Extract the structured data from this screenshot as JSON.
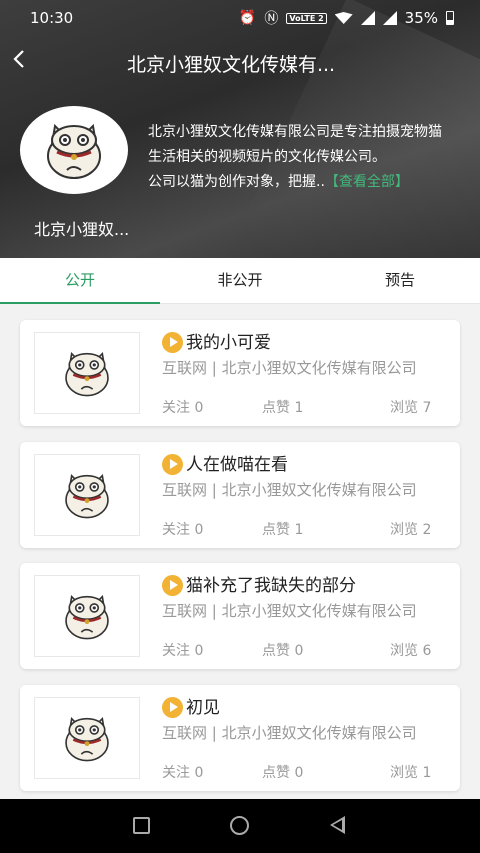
{
  "status_bar": {
    "time": "10:30",
    "volte": "VoLTE 2",
    "battery_pct": "35%",
    "icons": [
      "alarm-icon",
      "nfc-icon",
      "volte-icon",
      "wifi-icon",
      "signal-icon",
      "signal-icon",
      "battery-icon"
    ]
  },
  "header": {
    "back_icon": "chevron-left-icon",
    "title": "北京小狸奴文化传媒有...",
    "company_name": "北京小狸奴...",
    "description": "北京小狸奴文化传媒有限公司是专注拍摄宠物猫生活相关的视频短片的文化传媒公司。",
    "description_line2": "公司以猫为创作对象，把握..",
    "see_all": "【查看全部】"
  },
  "tabs": [
    {
      "label": "公开",
      "active": true
    },
    {
      "label": "非公开",
      "active": false
    },
    {
      "label": "预告",
      "active": false
    }
  ],
  "colors": {
    "accent": "#2a9d63",
    "play": "#f2b233",
    "muted": "#999999"
  },
  "videos": [
    {
      "title": "我的小可爱",
      "sub": "互联网 | 北京小狸奴文化传媒有限公司",
      "follow": "关注 0",
      "likes": "点赞 1",
      "views": "浏览 7"
    },
    {
      "title": "人在做喵在看",
      "sub": "互联网 | 北京小狸奴文化传媒有限公司",
      "follow": "关注 0",
      "likes": "点赞 1",
      "views": "浏览 2"
    },
    {
      "title": "猫补充了我缺失的部分",
      "sub": "互联网 | 北京小狸奴文化传媒有限公司",
      "follow": "关注 0",
      "likes": "点赞 0",
      "views": "浏览 6"
    },
    {
      "title": "初见",
      "sub": "互联网 | 北京小狸奴文化传媒有限公司",
      "follow": "关注 0",
      "likes": "点赞 0",
      "views": "浏览 1"
    }
  ],
  "nav": [
    "recent-apps-icon",
    "home-icon",
    "back-icon"
  ]
}
